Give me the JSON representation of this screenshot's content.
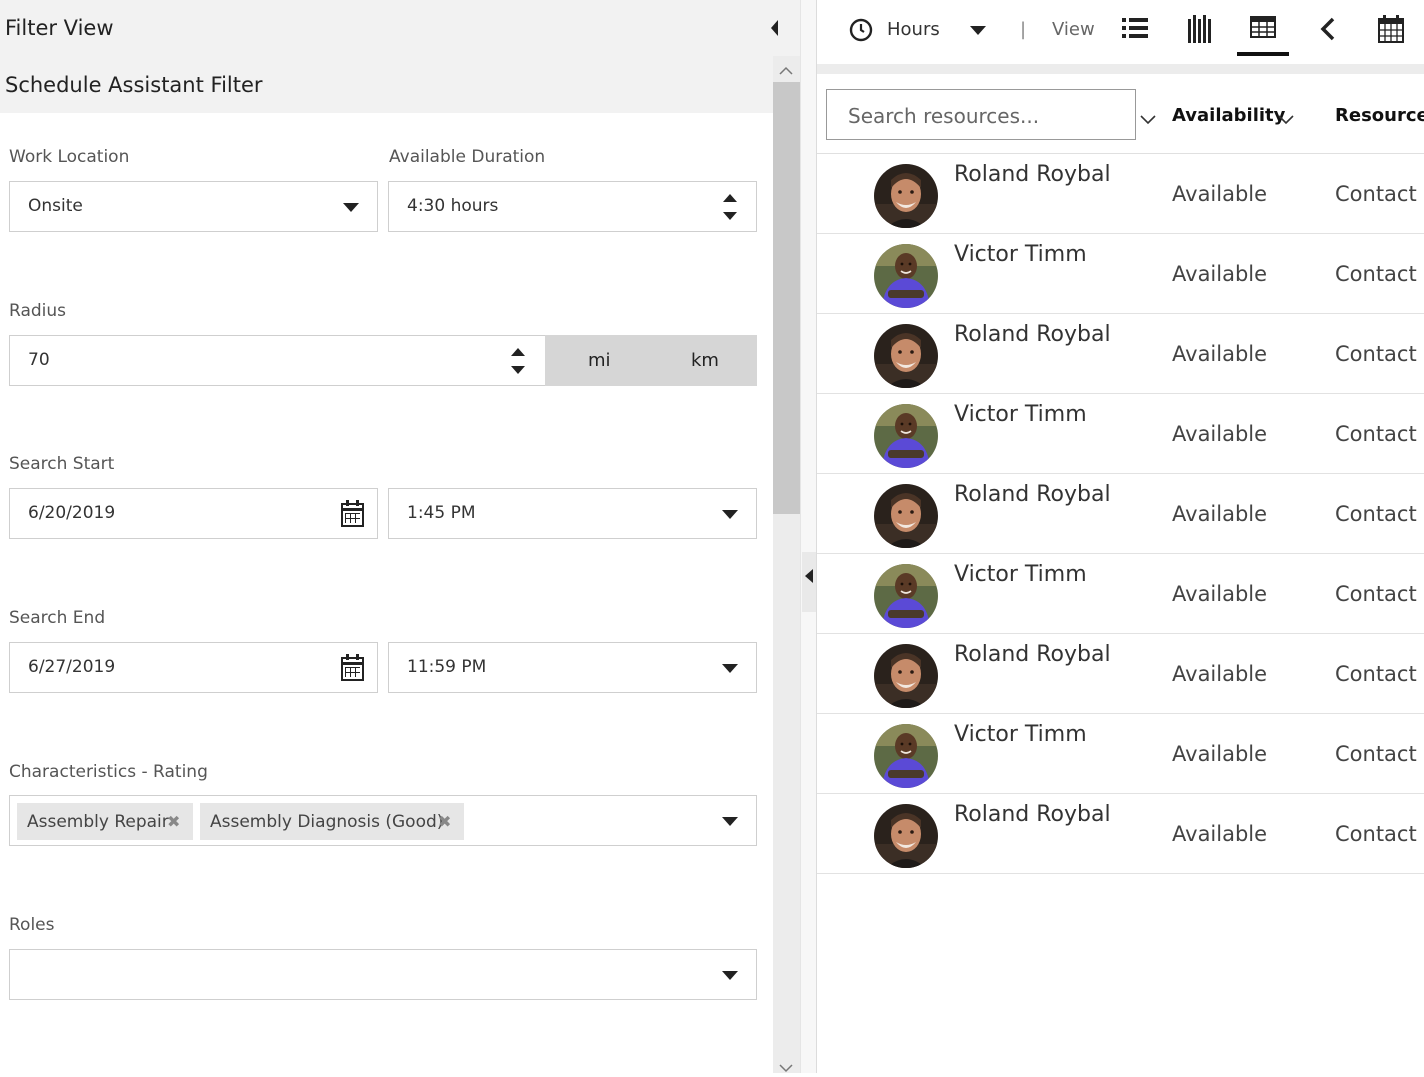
{
  "filter_panel": {
    "title": "Filter View",
    "section_title": "Schedule Assistant Filter",
    "work_location": {
      "label": "Work Location",
      "value": "Onsite"
    },
    "available_duration": {
      "label": "Available Duration",
      "value": "4:30 hours"
    },
    "radius": {
      "label": "Radius",
      "value": "70",
      "unit_mi": "mi",
      "unit_km": "km"
    },
    "search_start": {
      "label": "Search Start",
      "date": "6/20/2019",
      "time": "1:45 PM"
    },
    "search_end": {
      "label": "Search End",
      "date": "6/27/2019",
      "time": "11:59 PM"
    },
    "characteristics": {
      "label": "Characteristics - Rating",
      "tags": [
        "Assembly Repair",
        "Assembly Diagnosis (Good)"
      ]
    },
    "roles": {
      "label": "Roles",
      "value": ""
    }
  },
  "toolbar": {
    "hours_label": "Hours",
    "separator": "|",
    "view_label": "View"
  },
  "resources": {
    "search_placeholder": "Search resources...",
    "columns": {
      "availability": "Availability",
      "resource_type": "Resource T"
    },
    "rows": [
      {
        "name": "Roland Roybal",
        "availability": "Available",
        "type": "Contact",
        "avatar": "roland"
      },
      {
        "name": "Victor Timm",
        "availability": "Available",
        "type": "Contact",
        "avatar": "victor"
      },
      {
        "name": "Roland Roybal",
        "availability": "Available",
        "type": "Contact",
        "avatar": "roland"
      },
      {
        "name": "Victor Timm",
        "availability": "Available",
        "type": "Contact",
        "avatar": "victor"
      },
      {
        "name": "Roland Roybal",
        "availability": "Available",
        "type": "Contact",
        "avatar": "roland"
      },
      {
        "name": "Victor Timm",
        "availability": "Available",
        "type": "Contact",
        "avatar": "victor"
      },
      {
        "name": "Roland Roybal",
        "availability": "Available",
        "type": "Contact",
        "avatar": "roland"
      },
      {
        "name": "Victor Timm",
        "availability": "Available",
        "type": "Contact",
        "avatar": "victor"
      },
      {
        "name": "Roland Roybal",
        "availability": "Available",
        "type": "Contact",
        "avatar": "roland"
      }
    ]
  },
  "colors": {
    "panel_bg": "#f2f2f2",
    "unit_toggle_bg": "#d6d6d6",
    "tag_bg": "#e6e6e6",
    "victor_shirt": "#5b4ad6"
  }
}
